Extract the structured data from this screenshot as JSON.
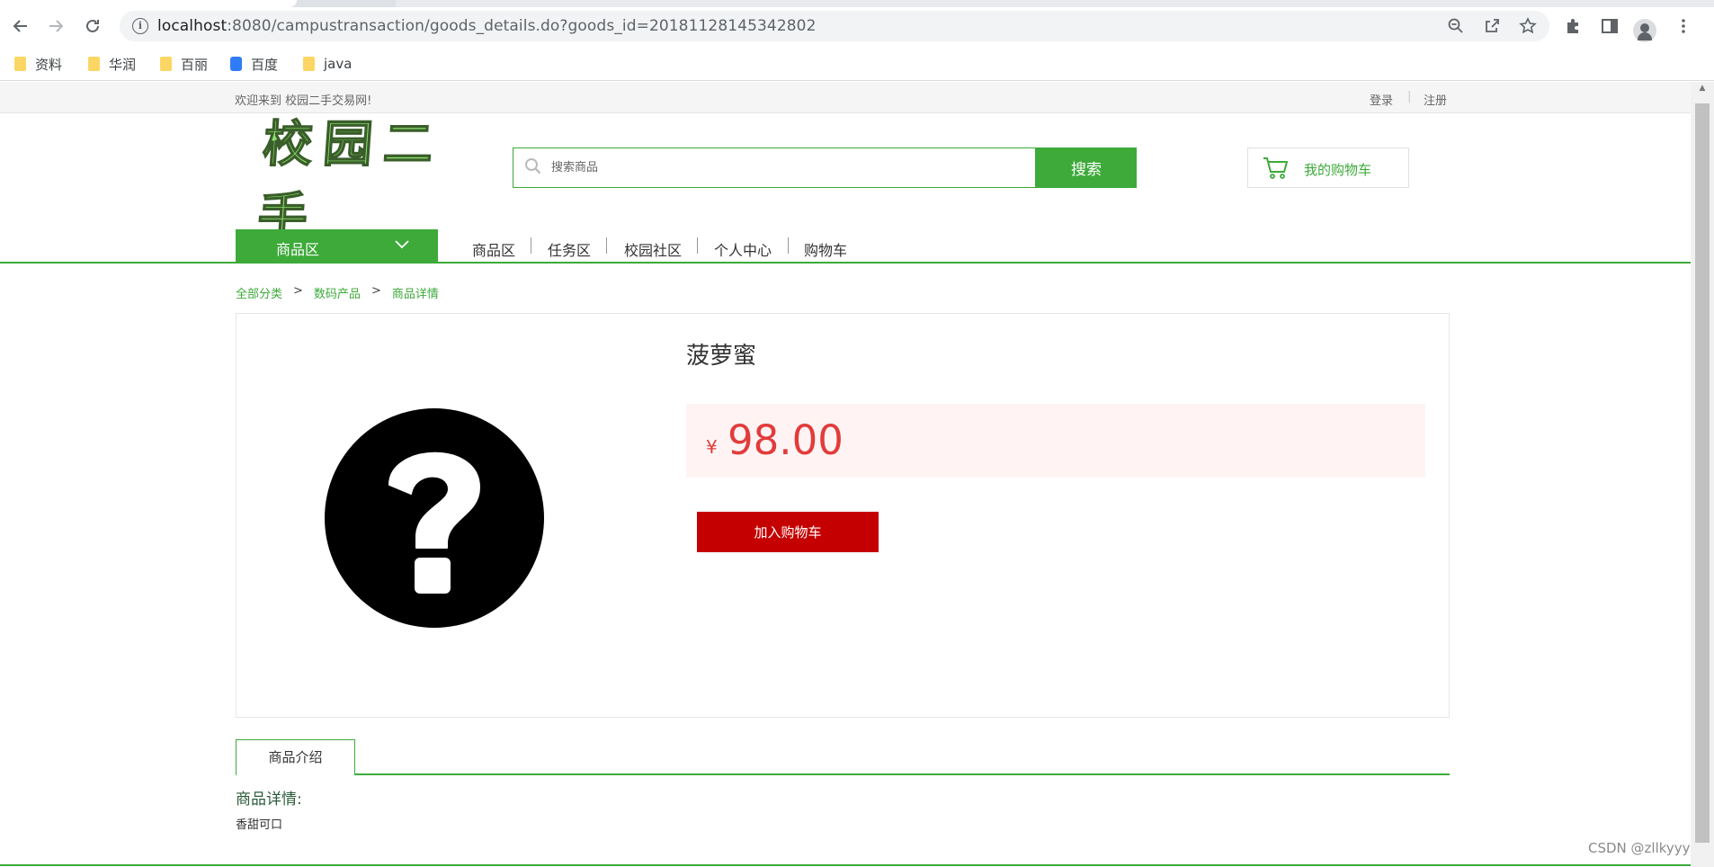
{
  "browser": {
    "url_host": "localhost",
    "url_path": ":8080/campustransaction/goods_details.do?goods_id=20181128145342802",
    "bookmarks": [
      "资料",
      "华润",
      "百丽",
      "百度",
      "java"
    ]
  },
  "topbar": {
    "welcome": "欢迎来到 校园二手交易网!",
    "login": "登录",
    "separator": "|",
    "register": "注册"
  },
  "header": {
    "logo_text": "校园二手",
    "search_placeholder": "搜索商品",
    "search_button": "搜索",
    "cart_label": "我的购物车"
  },
  "nav": {
    "category_button": "商品区",
    "links": [
      "商品区",
      "任务区",
      "校园社区",
      "个人中心",
      "购物车"
    ]
  },
  "breadcrumb": [
    "全部分类",
    "数码产品",
    "商品详情"
  ],
  "breadcrumb_sep": ">",
  "product": {
    "name": "菠萝蜜",
    "currency": "¥",
    "price": "98.00",
    "add_to_cart": "加入购物车"
  },
  "tabs": {
    "active": "商品介绍"
  },
  "details": {
    "title": "商品详情:",
    "text": "香甜可口"
  },
  "watermark": "CSDN @zllkyyy",
  "colors": {
    "brand_green": "#3daa3a",
    "price_red": "#e23b3b",
    "button_red": "#c50000"
  }
}
